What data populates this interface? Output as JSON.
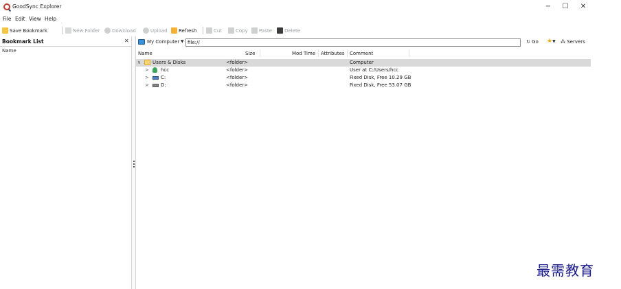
{
  "window": {
    "title": "GoodSync Explorer",
    "controls": {
      "minimize": "−",
      "maximize": "☐",
      "close": "✕"
    }
  },
  "menu": [
    "File",
    "Edit",
    "View",
    "Help"
  ],
  "toolbar": {
    "save_bookmark": "Save Bookmark",
    "new_folder": "New Folder",
    "download": "Download",
    "upload": "Upload",
    "refresh": "Refresh",
    "cut": "Cut",
    "copy": "Copy",
    "paste": "Paste",
    "delete": "Delete"
  },
  "bookmarks": {
    "title": "Bookmark List",
    "close": "✕",
    "name_header": "Name"
  },
  "address": {
    "location": "My Computer",
    "caret": "▼",
    "path": "file://",
    "go": "Go",
    "servers": "Servers"
  },
  "columns": {
    "name": "Name",
    "size": "Size",
    "mod_time": "Mod Time",
    "attributes": "Attributes",
    "comment": "Comment"
  },
  "rows": [
    {
      "twisty": "∨",
      "icon": "folder-icon",
      "name": "Users & Disks",
      "size": "<folder>",
      "comment": "Computer"
    },
    {
      "twisty": ">",
      "icon": "user-icon",
      "name": "hcc",
      "size": "<folder>",
      "comment": "User at C:/Users/hcc"
    },
    {
      "twisty": ">",
      "icon": "drive-c-icon",
      "name": "C:",
      "size": "<folder>",
      "comment": "Fixed Disk, Free 10.29 GB"
    },
    {
      "twisty": ">",
      "icon": "drive-d-icon",
      "name": "D:",
      "size": "<folder>",
      "comment": "Fixed Disk, Free 53.07 GB"
    }
  ],
  "watermark": "最需教育",
  "colors": {
    "selected_row": "#d9d9d9",
    "folder": "#f7d672",
    "star": "#f0a81a",
    "watermark": "#1a1a8c"
  }
}
